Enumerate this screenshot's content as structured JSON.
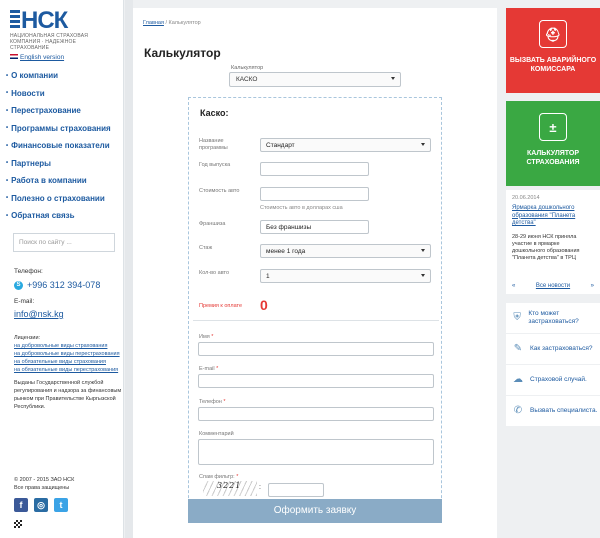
{
  "logo": {
    "name": "НСК",
    "subtitle": "НАЦИОНАЛЬНАЯ СТРАХОВАЯ КОМПАНИЯ · НАДЕЖНОЕ СТРАХОВАНИЕ"
  },
  "english_link": "English version",
  "nav": [
    "О компании",
    "Новости",
    "Перестрахование",
    "Программы страхования",
    "Финансовые показатели",
    "Партнеры",
    "Работа в компании",
    "Полезно о страховании",
    "Обратная связь"
  ],
  "search": {
    "placeholder": "Поиск по сайту ..."
  },
  "contacts": {
    "phone_label": "Телефон:",
    "phone": "+996 312 394-078",
    "email_label": "E-mail:",
    "email": "info@nsk.kg"
  },
  "licenses": {
    "label": "Лицензии:",
    "links": [
      "на добровольные виды страхования",
      "на добровольные виды перестрахования",
      "на обязательные виды страхования",
      "на обязательные виды перестрахования"
    ],
    "issued": "Выданы Государственной службой регулирования и надзора за финансовым рынком при Правительстве Кыргызской Республики."
  },
  "footer": {
    "copyright": "© 2007 - 2015 ЗАО НСК",
    "rights": "Все права защищены"
  },
  "social": [
    "f",
    "◎",
    "t"
  ],
  "breadcrumb": {
    "home": "Главная",
    "sep": "/",
    "current": "Калькулятор"
  },
  "page_title": "Калькулятор",
  "calculator": {
    "label": "Калькулятор",
    "selected": "КАСКО"
  },
  "form": {
    "title": "Каско:",
    "program_label": "Название программы",
    "program_value": "Стандарт",
    "year_label": "Год выпуска",
    "year_value": "",
    "cost_label": "Стоимость авто",
    "cost_value": "",
    "cost_hint": "Стоимость авто в долларах сша",
    "franchise_label": "Франшиза",
    "franchise_value": "Без франшизы",
    "experience_label": "Стаж",
    "experience_value": "менее 1 года",
    "count_label": "Кол-во авто",
    "count_value": "1",
    "premium_label": "Премия к оплате",
    "premium_value": "0",
    "name_label": "Имя",
    "email_label": "E-mail",
    "phone_label": "Телефон",
    "comment_label": "Комментарий",
    "captcha_label": "Спам фильтр:",
    "captcha_text": "3221",
    "colon": ":",
    "required_mark": "*",
    "submit": "Оформить заявку"
  },
  "right": {
    "commissar": "ВЫЗВАТЬ АВАРИЙНОГО КОМИССАРА",
    "calculator": "КАЛЬКУЛЯТОР СТРАХОВАНИЯ",
    "news": {
      "date": "20.06.2014",
      "title": "Ярмарка дошкольного образования \"Планета детства\"",
      "text": "28-29 июня НСК приняла участие в ярмарке дошкольного образования \"Планета детства\" в ТРЦ",
      "prev": "«",
      "all": "Все новости",
      "next": "»"
    },
    "faq": [
      "Кто может застраховаться?",
      "Как застраховаться?",
      "Страховой случай.",
      "Вызвать специалиста."
    ]
  },
  "colors": {
    "brand": "#1d5aa0",
    "red": "#e53935",
    "green": "#3aa843",
    "button": "#8aabc6"
  }
}
